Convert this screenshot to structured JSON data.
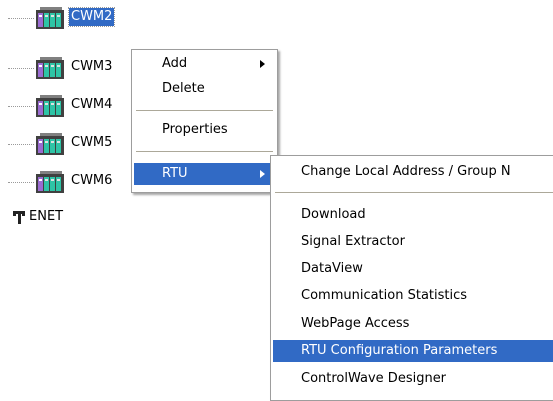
{
  "tree": {
    "nodes": [
      {
        "label": "CWM2",
        "selected": true
      },
      {
        "label": "CWM3",
        "selected": false
      },
      {
        "label": "CWM4",
        "selected": false
      },
      {
        "label": "CWM5",
        "selected": false
      },
      {
        "label": "CWM6",
        "selected": false
      }
    ],
    "enet_label": "ENET"
  },
  "context_menu": {
    "items": [
      {
        "label": "Add",
        "has_submenu": true
      },
      {
        "label": "Delete"
      },
      {
        "label": "Properties"
      },
      {
        "label": "RTU",
        "has_submenu": true,
        "selected": true
      }
    ]
  },
  "rtu_submenu": {
    "items": [
      {
        "label": "Change Local Address / Group N"
      },
      {
        "label": "Download"
      },
      {
        "label": "Signal Extractor"
      },
      {
        "label": "DataView"
      },
      {
        "label": "Communication Statistics"
      },
      {
        "label": "WebPage Access"
      },
      {
        "label": "RTU Configuration Parameters",
        "selected": true
      },
      {
        "label": "ControlWave Designer"
      }
    ]
  },
  "colors": {
    "selection": "#316ac5",
    "menu_border": "#9d9d9d"
  }
}
